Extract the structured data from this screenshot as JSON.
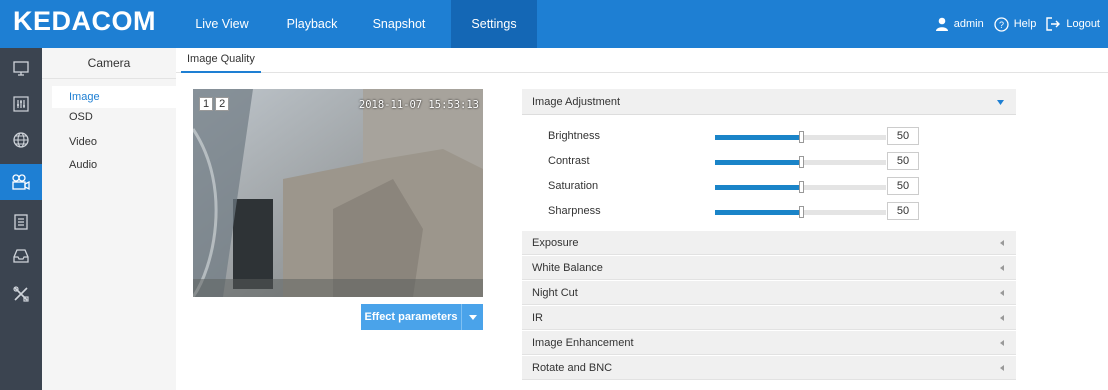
{
  "header": {
    "logo": "KEDACOM",
    "nav": [
      {
        "label": "Live View"
      },
      {
        "label": "Playback"
      },
      {
        "label": "Snapshot"
      },
      {
        "label": "Settings",
        "active": true
      }
    ],
    "user": {
      "name": "admin",
      "help": "Help",
      "logout": "Logout"
    }
  },
  "leftbar": {
    "icons": [
      "monitor-icon",
      "sliders-icon",
      "network-globe-icon",
      "camera-icon",
      "event-list-icon",
      "storage-tray-icon",
      "tools-icon"
    ],
    "active": "camera-icon"
  },
  "subnav": {
    "title": "Camera",
    "items": [
      {
        "label": "Image",
        "active": true
      },
      {
        "label": "OSD"
      },
      {
        "label": "Video"
      },
      {
        "label": "Audio"
      }
    ]
  },
  "tab": {
    "label": "Image Quality"
  },
  "video": {
    "channels": [
      "1",
      "2"
    ],
    "timestamp": "2018-11-07 15:53:13"
  },
  "effect_button": {
    "label": "Effect parameters"
  },
  "image_adjustment": {
    "title": "Image Adjustment",
    "sliders": [
      {
        "label": "Brightness",
        "value": "50",
        "fraction": 0.5
      },
      {
        "label": "Contrast",
        "value": "50",
        "fraction": 0.5
      },
      {
        "label": "Saturation",
        "value": "50",
        "fraction": 0.5
      },
      {
        "label": "Sharpness",
        "value": "50",
        "fraction": 0.5
      }
    ]
  },
  "panels": [
    {
      "label": "Exposure"
    },
    {
      "label": "White Balance"
    },
    {
      "label": "Night Cut"
    },
    {
      "label": "IR"
    },
    {
      "label": "Image Enhancement"
    },
    {
      "label": "Rotate and BNC"
    }
  ],
  "colors": {
    "accent": "#1e7fd3",
    "sidebar": "#3b4450",
    "slider": "#1a84c8"
  }
}
